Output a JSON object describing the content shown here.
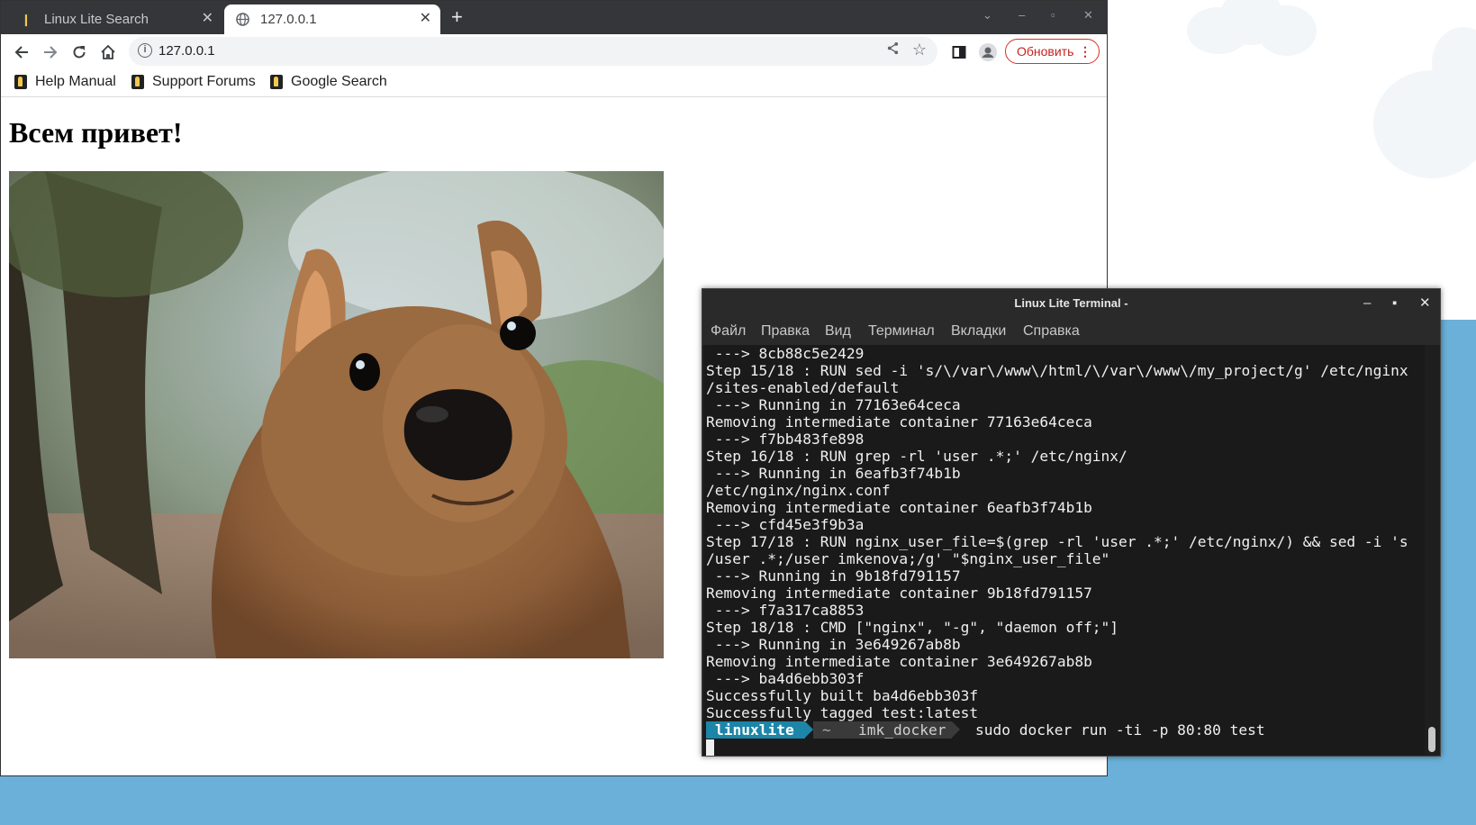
{
  "browser": {
    "tabs": [
      {
        "label": "Linux Lite Search",
        "icon": "linux-lite-icon"
      },
      {
        "label": "127.0.0.1",
        "icon": "globe-icon"
      }
    ],
    "url": "127.0.0.1",
    "update_button": "Обновить",
    "bookmarks": [
      {
        "label": "Help Manual"
      },
      {
        "label": "Support Forums"
      },
      {
        "label": "Google Search"
      }
    ],
    "page": {
      "heading": "Всем привет!",
      "image_alt": "quokka"
    }
  },
  "terminal": {
    "title": "Linux Lite Terminal -",
    "menu": [
      "Файл",
      "Правка",
      "Вид",
      "Терминал",
      "Вкладки",
      "Справка"
    ],
    "lines": [
      " ---> 8cb88c5e2429",
      "Step 15/18 : RUN sed -i 's/\\/var\\/www\\/html/\\/var\\/www\\/my_project/g' /etc/nginx",
      "/sites-enabled/default",
      " ---> Running in 77163e64ceca",
      "Removing intermediate container 77163e64ceca",
      " ---> f7bb483fe898",
      "Step 16/18 : RUN grep -rl 'user .*;' /etc/nginx/",
      " ---> Running in 6eafb3f74b1b",
      "/etc/nginx/nginx.conf",
      "Removing intermediate container 6eafb3f74b1b",
      " ---> cfd45e3f9b3a",
      "Step 17/18 : RUN nginx_user_file=$(grep -rl 'user .*;' /etc/nginx/) && sed -i 's",
      "/user .*;/user imkenova;/g' \"$nginx_user_file\"",
      " ---> Running in 9b18fd791157",
      "Removing intermediate container 9b18fd791157",
      " ---> f7a317ca8853",
      "Step 18/18 : CMD [\"nginx\", \"-g\", \"daemon off;\"]",
      " ---> Running in 3e649267ab8b",
      "Removing intermediate container 3e649267ab8b",
      " ---> ba4d6ebb303f",
      "Successfully built ba4d6ebb303f",
      "Successfully tagged test:latest"
    ],
    "prompt": {
      "user": "linuxlite",
      "home": "~",
      "dir": "imk_docker",
      "command": "sudo docker run -ti -p 80:80 test"
    }
  },
  "colors": {
    "prompt_user_bg": "#1c85a8",
    "update_button": "#d93025"
  }
}
